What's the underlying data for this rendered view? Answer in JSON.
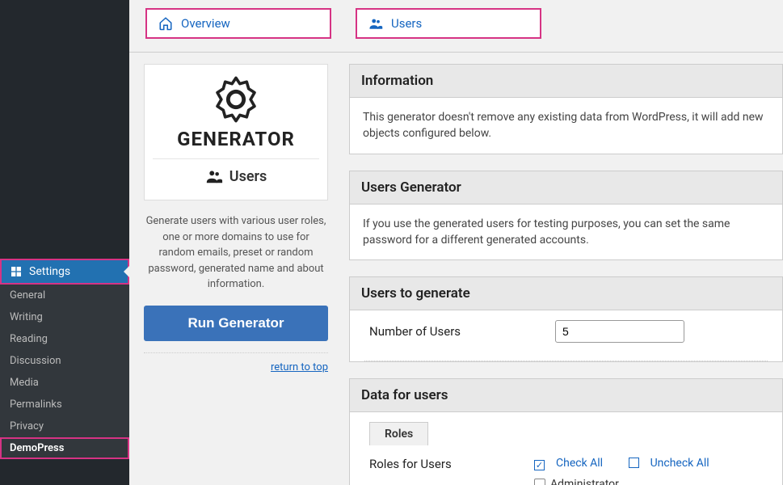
{
  "sidebar": {
    "settings_label": "Settings",
    "items": [
      "General",
      "Writing",
      "Reading",
      "Discussion",
      "Media",
      "Permalinks",
      "Privacy",
      "DemoPress"
    ]
  },
  "tabs": {
    "overview": "Overview",
    "users": "Users"
  },
  "generator": {
    "title": "GENERATOR",
    "sub": "Users",
    "description": "Generate users with various user roles, one or more domains to use for random emails, preset or random password, generated name and about information.",
    "run_label": "Run Generator",
    "return_label": "return to top"
  },
  "panels": {
    "info": {
      "title": "Information",
      "body": "This generator doesn't remove any existing data from WordPress, it will add new objects configured below."
    },
    "users_gen": {
      "title": "Users Generator",
      "body": "If you use the generated users for testing purposes, you can set the same password for a different generated accounts."
    },
    "to_generate": {
      "title": "Users to generate",
      "number_label": "Number of Users",
      "number_value": "5"
    },
    "data": {
      "title": "Data for users",
      "subtab": "Roles",
      "roles_label": "Roles for Users",
      "check_all": "Check All",
      "uncheck_all": "Uncheck All",
      "role_0": "Administrator"
    }
  }
}
